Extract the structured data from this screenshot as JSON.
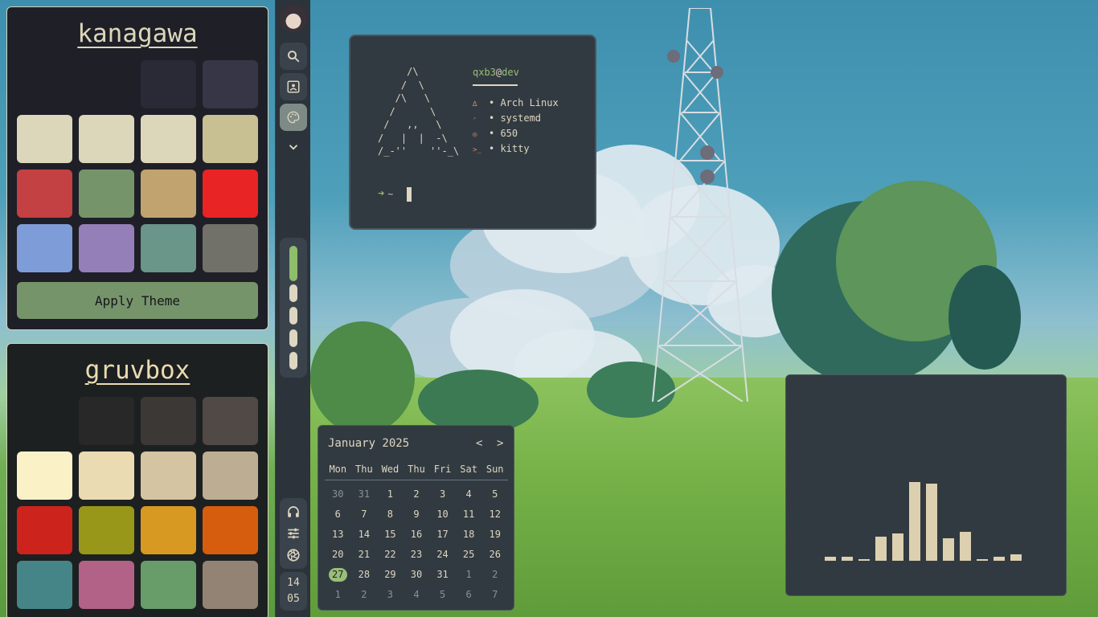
{
  "themes": [
    {
      "name": "kanagawa",
      "swatches": [
        "#1f1f28",
        "#1f1f28",
        "#2a2a37",
        "#363646",
        "#dcd7ba",
        "#dcd7ba",
        "#dcd7ba",
        "#c8c093",
        "#c34043",
        "#76946a",
        "#c0a36e",
        "#e82424",
        "#7e9cd8",
        "#957fb8",
        "#6a9589",
        "#727169"
      ],
      "apply_label": "Apply Theme"
    },
    {
      "name": "gruvbox",
      "swatches": [
        "#1d2021",
        "#282828",
        "#3c3836",
        "#504945",
        "#fbf1c7",
        "#ebdbb2",
        "#d5c4a1",
        "#bdae93",
        "#cc241d",
        "#98971a",
        "#d79921",
        "#d65d0e",
        "#458588",
        "#b16286",
        "#689d6a",
        "#928374"
      ]
    }
  ],
  "sidebar": {
    "icons": [
      "avatar",
      "search-icon",
      "screenshot-icon",
      "palette-icon",
      "chevron-down-icon"
    ],
    "workspaces": [
      {
        "active": true
      },
      {
        "active": false
      },
      {
        "active": false
      },
      {
        "active": false
      },
      {
        "active": false
      }
    ],
    "system_icons": [
      "headphones-icon",
      "sliders-icon",
      "aperture-icon"
    ],
    "clock": {
      "hour": "14",
      "minute": "05"
    }
  },
  "terminal": {
    "user": "qxb3",
    "at": "@",
    "host": "dev",
    "info": [
      {
        "icon": "arch-icon",
        "glyph": "∆",
        "text": "• Arch Linux"
      },
      {
        "icon": "init-icon",
        "glyph": "◜",
        "text": "• systemd"
      },
      {
        "icon": "package-icon",
        "glyph": "◎",
        "text": "• 650"
      },
      {
        "icon": "terminal-icon",
        "glyph": ">_",
        "text": "• kitty"
      }
    ],
    "prompt_arrow": "➔",
    "prompt_path": "~",
    "ascii": "     /\\\n    /  \\\n   /\\   \\\n  /      \\\n /   ,,   \\\n/   |  |  -\\\n/_-''    ''-_\\"
  },
  "calendar": {
    "title": "January 2025",
    "prev": "<",
    "next": ">",
    "dow": [
      "Mon",
      "Thu",
      "Wed",
      "Thu",
      "Fri",
      "Sat",
      "Sun"
    ],
    "weeks": [
      [
        {
          "d": "30",
          "m": true
        },
        {
          "d": "31",
          "m": true
        },
        {
          "d": "1"
        },
        {
          "d": "2"
        },
        {
          "d": "3"
        },
        {
          "d": "4"
        },
        {
          "d": "5"
        }
      ],
      [
        {
          "d": "6"
        },
        {
          "d": "7"
        },
        {
          "d": "8"
        },
        {
          "d": "9"
        },
        {
          "d": "10"
        },
        {
          "d": "11"
        },
        {
          "d": "12"
        }
      ],
      [
        {
          "d": "13"
        },
        {
          "d": "14"
        },
        {
          "d": "15"
        },
        {
          "d": "16"
        },
        {
          "d": "17"
        },
        {
          "d": "18"
        },
        {
          "d": "19"
        }
      ],
      [
        {
          "d": "20"
        },
        {
          "d": "21"
        },
        {
          "d": "22"
        },
        {
          "d": "23"
        },
        {
          "d": "24"
        },
        {
          "d": "25"
        },
        {
          "d": "26"
        }
      ],
      [
        {
          "d": "27",
          "t": true
        },
        {
          "d": "28"
        },
        {
          "d": "29"
        },
        {
          "d": "30"
        },
        {
          "d": "31"
        },
        {
          "d": "1",
          "m": true
        },
        {
          "d": "2",
          "m": true
        }
      ],
      [
        {
          "d": "1",
          "m": true
        },
        {
          "d": "2",
          "m": true
        },
        {
          "d": "3",
          "m": true
        },
        {
          "d": "4",
          "m": true
        },
        {
          "d": "5",
          "m": true
        },
        {
          "d": "6",
          "m": true
        },
        {
          "d": "7",
          "m": true
        }
      ]
    ]
  },
  "visualizer": {
    "levels": [
      0.04,
      0.04,
      0.015,
      0.25,
      0.28,
      0.82,
      0.8,
      0.23,
      0.3,
      0.01,
      0.04,
      0.07
    ],
    "bar_color": "#dcd0b0"
  }
}
